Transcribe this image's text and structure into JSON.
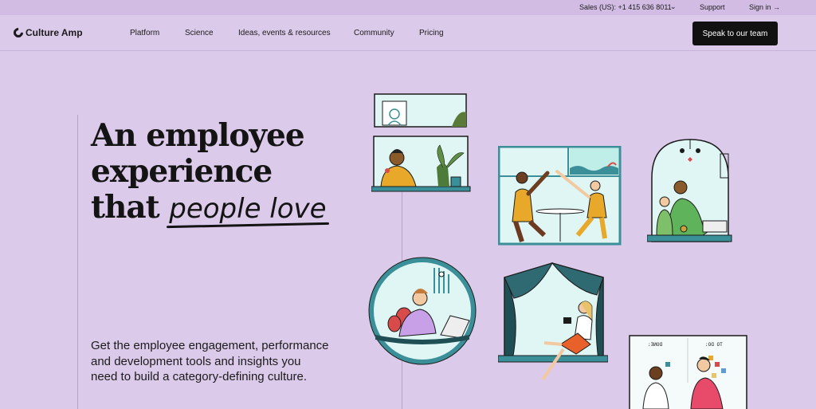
{
  "utility": {
    "sales": "Sales (US): +1 415 636 8011",
    "support": "Support",
    "signin": "Sign in →"
  },
  "nav": {
    "brand": "Culture Amp",
    "links": [
      "Platform",
      "Science",
      "Ideas, events & resources",
      "Community",
      "Pricing"
    ],
    "cta": "Speak to our team"
  },
  "hero": {
    "line1": "An employee",
    "line2": "experience",
    "line3_prefix": "that ",
    "line3_script": "people love",
    "subtitle": "Get the employee engagement, performance and development tools and insights you need to build a category-defining culture."
  },
  "illustration_labels": {
    "board_left": "DONE:",
    "board_right": "TO DO:"
  },
  "colors": {
    "background": "#dccaea",
    "utility_bar": "#d2bce4",
    "cta": "#111111",
    "teal": "#3a8f98",
    "mint": "#d9f6f3"
  },
  "icons": [
    "logo-icon",
    "chevron-down-icon",
    "arrow-right-icon"
  ]
}
